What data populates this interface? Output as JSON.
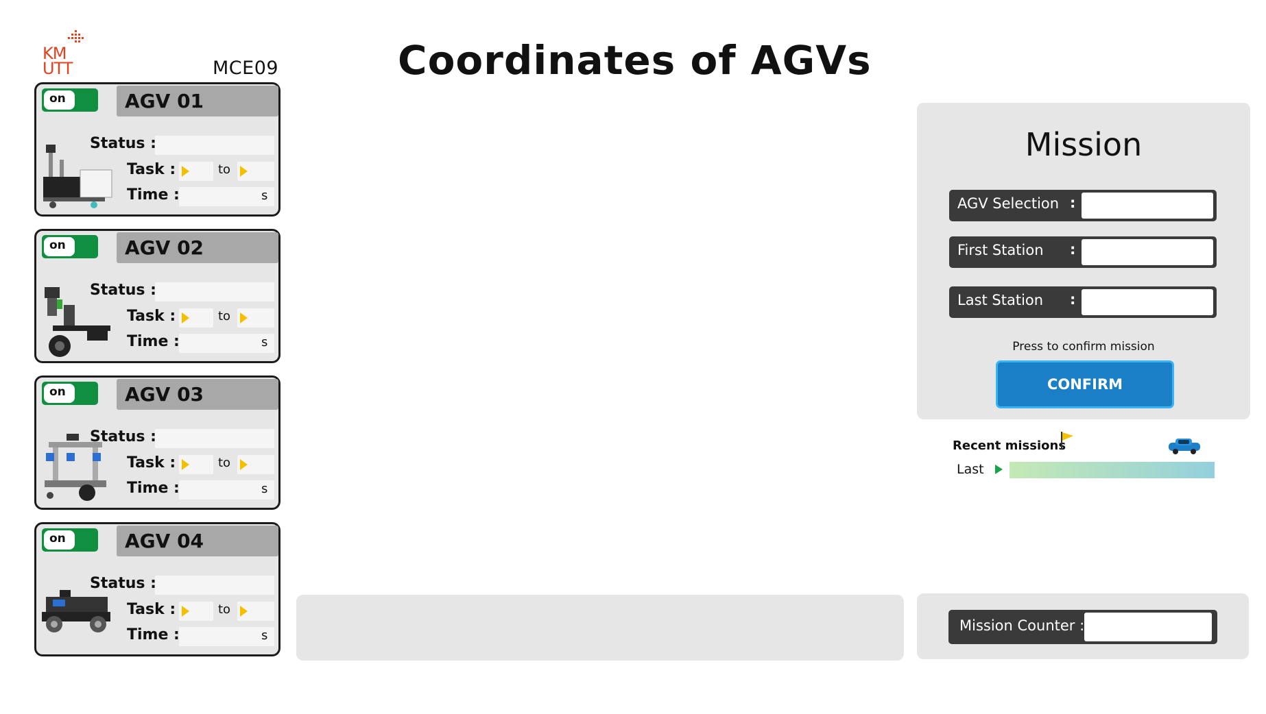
{
  "logo": {
    "line1": "KM",
    "line2": "UTT"
  },
  "header": {
    "code": "MCE09",
    "title": "Coordinates of AGVs"
  },
  "agvs": [
    {
      "name": "AGV 01",
      "toggle": "on",
      "status_label": "Status :",
      "task_label": "Task :",
      "to_label": "to",
      "time_label": "Time :",
      "time_unit": "s",
      "status": "",
      "task_from": "",
      "task_to": "",
      "time": ""
    },
    {
      "name": "AGV 02",
      "toggle": "on",
      "status_label": "Status :",
      "task_label": "Task :",
      "to_label": "to",
      "time_label": "Time :",
      "time_unit": "s",
      "status": "",
      "task_from": "",
      "task_to": "",
      "time": ""
    },
    {
      "name": "AGV 03",
      "toggle": "on",
      "status_label": "Status :",
      "task_label": "Task :",
      "to_label": "to",
      "time_label": "Time :",
      "time_unit": "s",
      "status": "",
      "task_from": "",
      "task_to": "",
      "time": ""
    },
    {
      "name": "AGV 04",
      "toggle": "on",
      "status_label": "Status :",
      "task_label": "Task :",
      "to_label": "to",
      "time_label": "Time :",
      "time_unit": "s",
      "status": "",
      "task_from": "",
      "task_to": "",
      "time": ""
    }
  ],
  "mission": {
    "title": "Mission",
    "rows": [
      {
        "label": "AGV Selection",
        "colon": ":",
        "value": ""
      },
      {
        "label": "First Station",
        "colon": ":",
        "value": ""
      },
      {
        "label": "Last Station",
        "colon": ":",
        "value": ""
      }
    ],
    "press_text": "Press to confirm mission",
    "confirm_label": "CONFIRM"
  },
  "recent": {
    "label": "Recent missions",
    "last_label": "Last"
  },
  "counter": {
    "label": "Mission Counter :",
    "value": ""
  },
  "colors": {
    "toggle_on": "#0f8f3f",
    "confirm": "#1a7fc4",
    "arrow": "#f3c000",
    "last_arrow": "#16a34a"
  },
  "icons": {
    "flag": "flag-icon",
    "car": "car-icon",
    "arrow": "play-arrow-icon"
  }
}
